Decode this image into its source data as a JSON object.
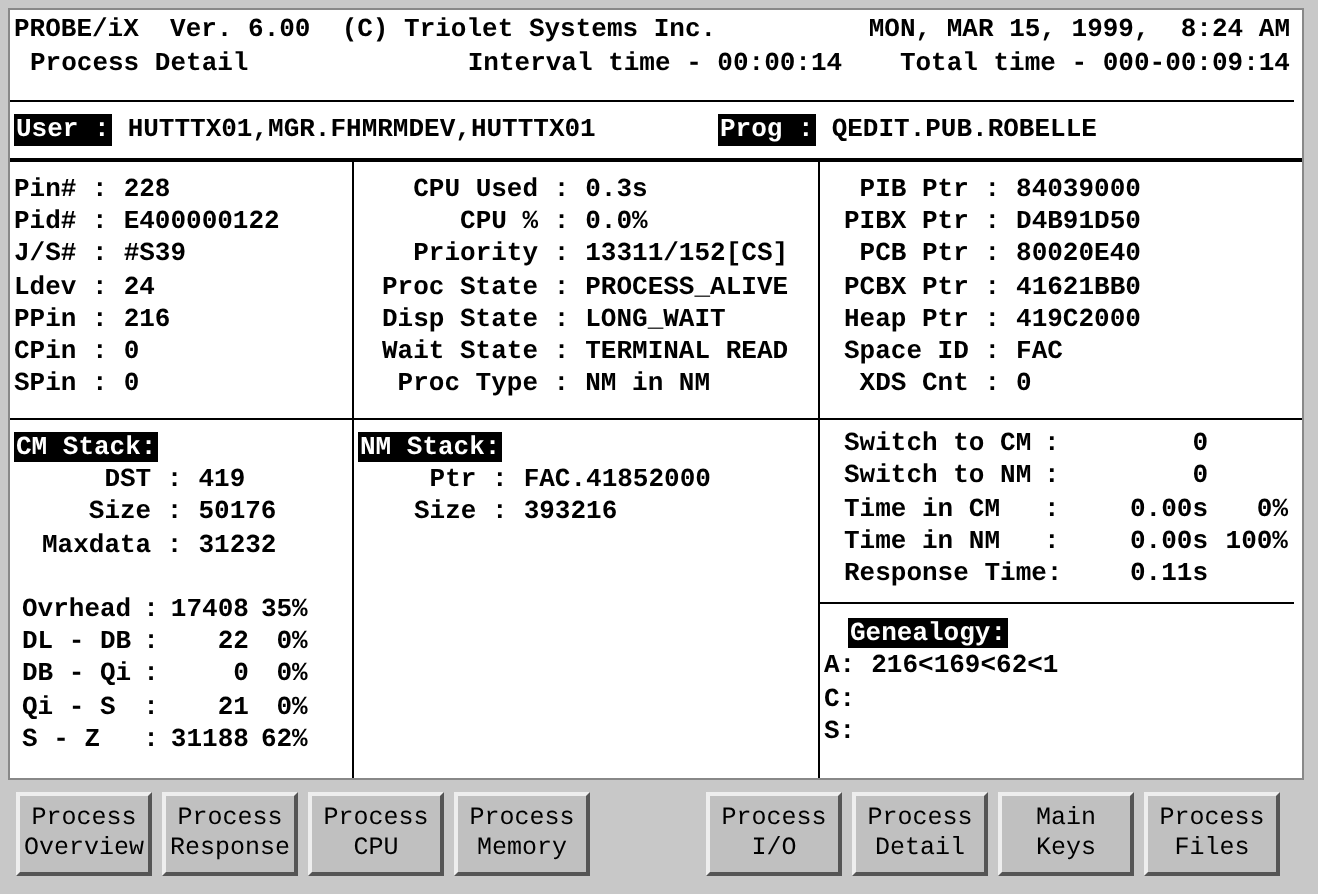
{
  "header": {
    "product": "PROBE/iX  Ver. 6.00  (C) Triolet Systems Inc.",
    "datetime": "MON, MAR 15, 1999,  8:24 AM",
    "screen": "Process Detail",
    "interval": "Interval time - 00:00:14",
    "total": "Total time - 000-00:09:14"
  },
  "ids": [
    {
      "label": "User :",
      "value": "HUTTTX01,MGR.FHMRMDEV,HUTTTX01"
    },
    {
      "label": "Prog :",
      "value": "QEDIT.PUB.ROBELLE"
    }
  ],
  "process": [
    {
      "label": "Pin# :",
      "value": "228"
    },
    {
      "label": "Pid# :",
      "value": "E400000122"
    },
    {
      "label": "J/S# :",
      "value": "#S39"
    },
    {
      "label": "Ldev :",
      "value": "24"
    },
    {
      "label": "PPin :",
      "value": "216"
    },
    {
      "label": "CPin :",
      "value": "0"
    },
    {
      "label": "SPin :",
      "value": "0"
    }
  ],
  "cpu": [
    {
      "label": "CPU Used :",
      "value": "0.3s"
    },
    {
      "label": "CPU % :",
      "value": "0.0%"
    },
    {
      "label": "Priority :",
      "value": "13311/152[CS]"
    },
    {
      "label": "Proc State :",
      "value": "PROCESS_ALIVE"
    },
    {
      "label": "Disp State :",
      "value": "LONG_WAIT"
    },
    {
      "label": "Wait State :",
      "value": "TERMINAL READ"
    },
    {
      "label": "Proc Type :",
      "value": "NM in NM"
    }
  ],
  "pointers": [
    {
      "label": "PIB Ptr :",
      "value": "84039000"
    },
    {
      "label": "PIBX Ptr :",
      "value": "D4B91D50"
    },
    {
      "label": "PCB Ptr :",
      "value": "80020E40"
    },
    {
      "label": "PCBX Ptr :",
      "value": "41621BB0"
    },
    {
      "label": "Heap Ptr :",
      "value": "419C2000"
    },
    {
      "label": "Space ID :",
      "value": "FAC"
    },
    {
      "label": "XDS Cnt :",
      "value": "0"
    }
  ],
  "cm_stack": {
    "title": "CM Stack:",
    "rows": [
      {
        "label": "DST :",
        "value": "419"
      },
      {
        "label": "Size :",
        "value": "50176"
      },
      {
        "label": "Maxdata :",
        "value": "31232"
      }
    ],
    "regions": [
      {
        "label": "Ovrhead",
        "colon": ":",
        "value": "17408",
        "percent": "35%"
      },
      {
        "label": "DL - DB",
        "colon": ":",
        "value": "22",
        "percent": "0%"
      },
      {
        "label": "DB - Qi",
        "colon": ":",
        "value": "0",
        "percent": "0%"
      },
      {
        "label": "Qi - S",
        "colon": ":",
        "value": "21",
        "percent": "0%"
      },
      {
        "label": "S - Z",
        "colon": ":",
        "value": "31188",
        "percent": "62%"
      }
    ]
  },
  "nm_stack": {
    "title": "NM Stack:",
    "rows": [
      {
        "label": "Ptr :",
        "value": "FAC.41852000"
      },
      {
        "label": "Size :",
        "value": "393216"
      }
    ]
  },
  "switches": [
    {
      "label": "Switch to CM",
      "colon": ":",
      "value": "0"
    },
    {
      "label": "Switch to NM",
      "colon": ":",
      "value": "0"
    },
    {
      "label": "Time in CM",
      "colon": ":",
      "value": "0.00s",
      "percent": "0%"
    },
    {
      "label": "Time in NM",
      "colon": ":",
      "value": "0.00s",
      "percent": "100%"
    },
    {
      "label": "Response Time:",
      "value": "0.11s"
    }
  ],
  "genealogy": {
    "title": "Genealogy:",
    "rows": [
      {
        "label": "A:",
        "value": "216<169<62<1"
      },
      {
        "label": "C:"
      },
      {
        "label": "S:"
      }
    ]
  },
  "function_keys": [
    {
      "label": "Process\nOverview"
    },
    {
      "label": "Process\nResponse"
    },
    {
      "label": "Process\nCPU"
    },
    {
      "label": "Process\nMemory"
    },
    {
      "label": "Process\nI/O"
    },
    {
      "label": "Process\nDetail"
    },
    {
      "label": "Main\nKeys"
    },
    {
      "label": "Process\nFiles"
    }
  ]
}
